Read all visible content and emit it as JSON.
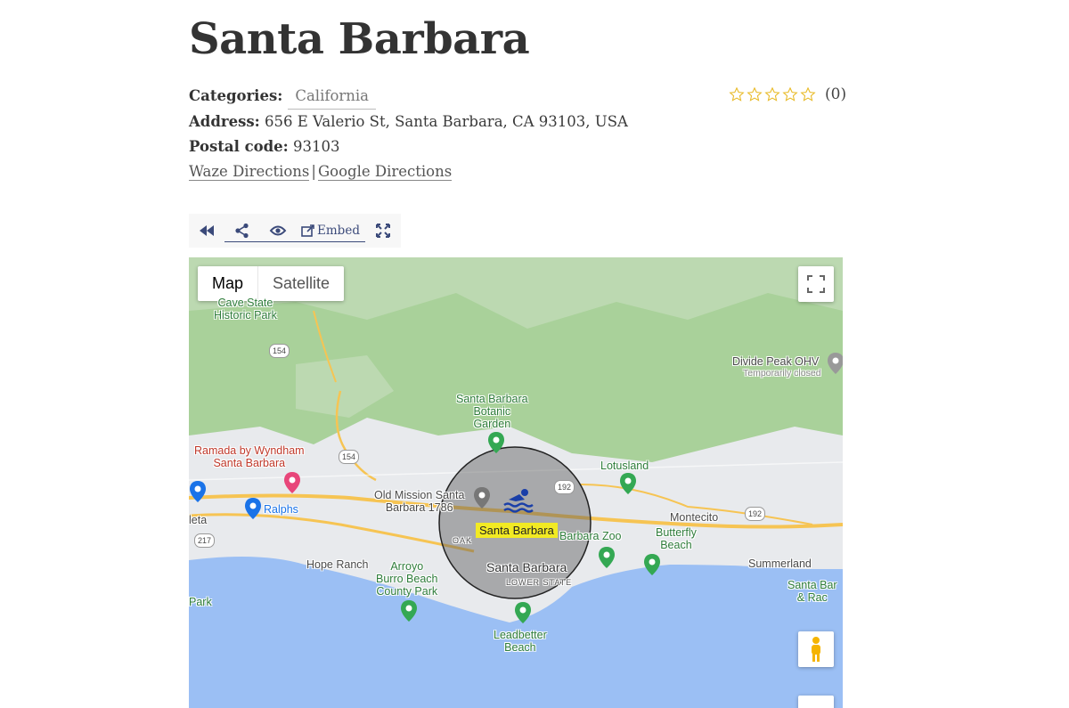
{
  "page": {
    "title": "Santa Barbara",
    "categories_label": "Categories:",
    "category": "California",
    "address_label": "Address:",
    "address": "656 E Valerio St, Santa Barbara, CA 93103, USA",
    "postal_label": "Postal code:",
    "postal_code": "93103",
    "waze_link": "Waze Directions",
    "separator": "|",
    "google_link": "Google Directions"
  },
  "rating": {
    "stars_filled": 0,
    "stars_total": 5,
    "count_text": "(0)",
    "star_color": "#e8b923"
  },
  "toolbar": {
    "back_icon": "rewind-icon",
    "share_icon": "share-icon",
    "eye_icon": "eye-icon",
    "embed_label": "Embed",
    "fullscreen_icon": "arrows-expand-icon",
    "accent": "#3b4a7a"
  },
  "map": {
    "type_map": "Map",
    "type_satellite": "Satellite",
    "marker_label": "Santa Barbara",
    "labels": {
      "cave": "Cave State\nHistoric Park",
      "divide": "Divide Peak OHV",
      "divide_sub": "Temporarily closed",
      "botanic": "Santa Barbara\nBotanic\nGarden",
      "ramada": "Ramada by Wyndham\nSanta Barbara",
      "lotusland": "Lotusland",
      "mission": "Old Mission Santa\nBarbara 1786",
      "ralphs": "Ralphs",
      "montecito": "Montecito",
      "leta": "leta",
      "zoo": "Barbara Zoo",
      "butterfly": "Butterfly\nBeach",
      "hope": "Hope Ranch",
      "arroyo": "Arroyo\nBurro Beach\nCounty Park",
      "sb": "Santa Barbara",
      "lower": "LOWER STATE",
      "oak": "OAK",
      "summerland": "Summerland",
      "sbrac": "Santa Bar\n& Rac",
      "park": "Park",
      "leadbetter": "Leadbetter\nBeach",
      "r154a": "154",
      "r154b": "154",
      "r192a": "192",
      "r192b": "192",
      "r217": "217"
    },
    "colors": {
      "water": "#9bbff4",
      "land": "#e8eaed",
      "forest": "#a9d19a",
      "road": "#f6c453",
      "circle": "rgba(90,90,90,0.45)"
    }
  }
}
